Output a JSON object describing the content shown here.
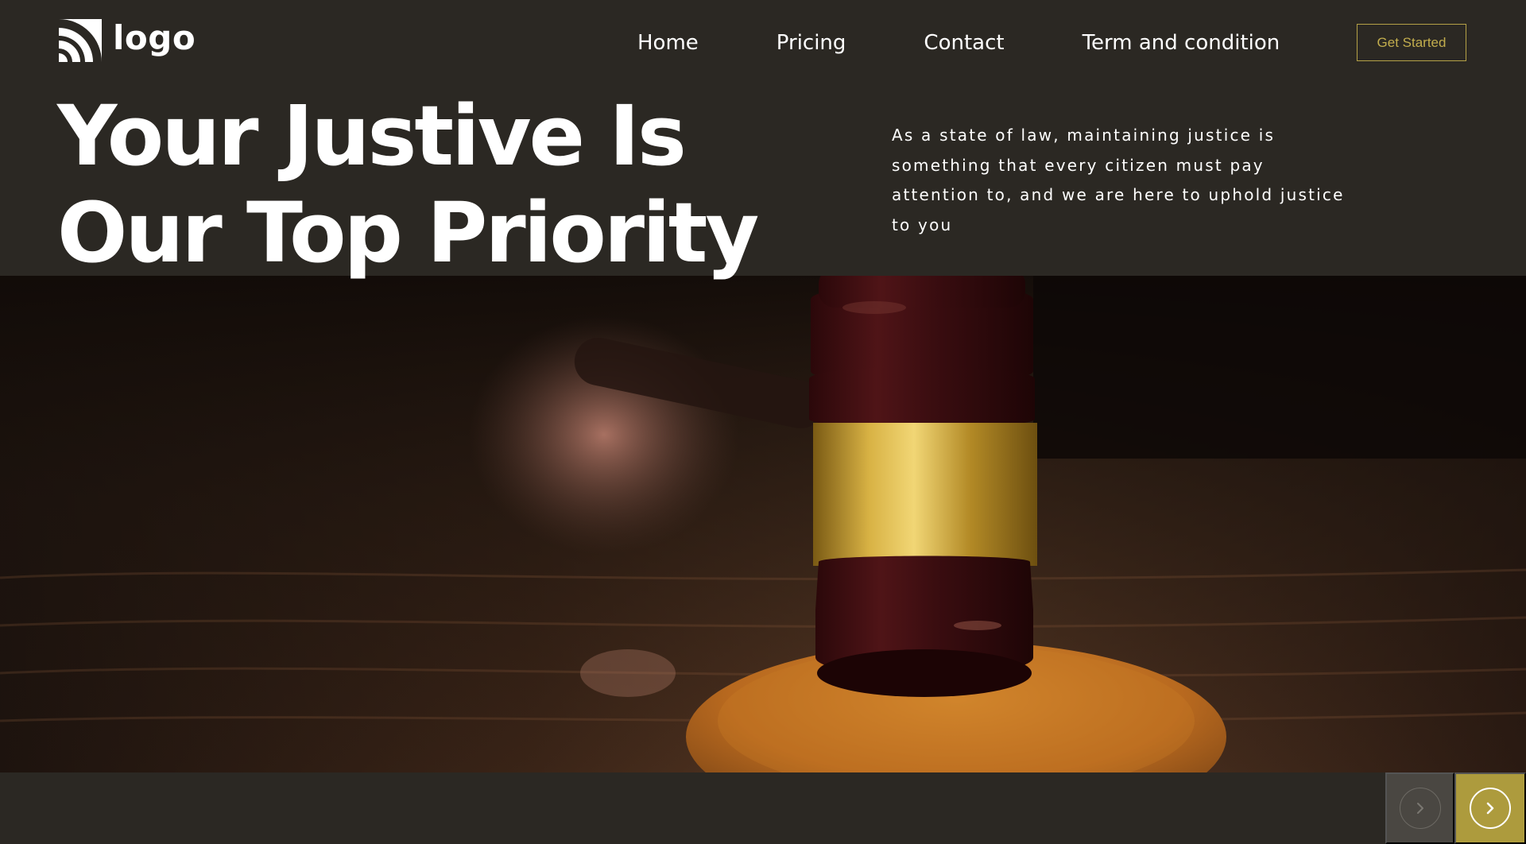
{
  "brand": {
    "logo_text": "logo",
    "logo_icon": "logo-arcs-icon"
  },
  "nav": {
    "items": [
      {
        "label": "Home"
      },
      {
        "label": "Pricing"
      },
      {
        "label": "Contact"
      },
      {
        "label": "Term and condition"
      }
    ],
    "cta_label": "Get Started"
  },
  "hero": {
    "title_line1": "Your Justive Is",
    "title_line2": "Our Top Priority",
    "description": "As a state of law, maintaining justice is something that every citizen must pay attention to, and we are here to uphold justice to you",
    "image_subject": "judge gavel on wooden sound block"
  },
  "slider": {
    "prev_icon": "chevron-right-icon",
    "next_icon": "chevron-right-icon"
  },
  "colors": {
    "background": "#2b2823",
    "accent": "#ad9b3d",
    "accent_text": "#c2ad4d",
    "prev_button_bg": "#4a4742",
    "text": "#ffffff"
  }
}
